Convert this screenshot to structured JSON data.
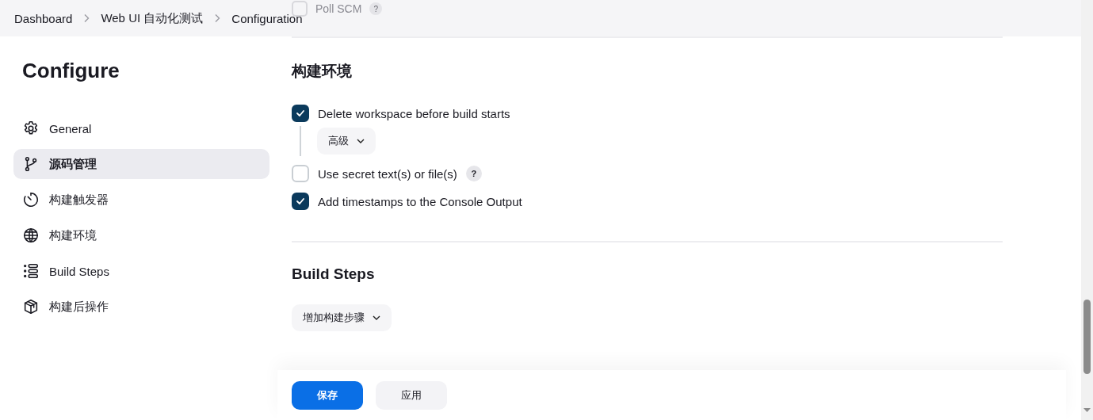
{
  "breadcrumbs": [
    {
      "label": "Dashboard"
    },
    {
      "label": "Web UI 自动化测试"
    },
    {
      "label": "Configuration"
    }
  ],
  "behind_header": {
    "label": "Poll SCM",
    "checked": false,
    "help": "?"
  },
  "sidebar": {
    "title": "Configure",
    "items": [
      {
        "label": "General",
        "selected": false
      },
      {
        "label": "源码管理",
        "selected": true
      },
      {
        "label": "构建触发器",
        "selected": false
      },
      {
        "label": "构建环境",
        "selected": false
      },
      {
        "label": "Build Steps",
        "selected": false
      },
      {
        "label": "构建后操作",
        "selected": false
      }
    ]
  },
  "build_environment": {
    "title": "构建环境",
    "options": [
      {
        "label": "Delete workspace before build starts",
        "checked": true,
        "advanced": "高级"
      },
      {
        "label": "Use secret text(s) or file(s)",
        "checked": false,
        "help": "?"
      },
      {
        "label": "Add timestamps to the Console Output",
        "checked": true
      }
    ]
  },
  "build_steps": {
    "title": "Build Steps",
    "add_button": "增加构建步骤"
  },
  "footer": {
    "buttons": [
      {
        "label": "保存",
        "kind": "primary"
      },
      {
        "label": "应用",
        "kind": "secondary"
      }
    ]
  }
}
